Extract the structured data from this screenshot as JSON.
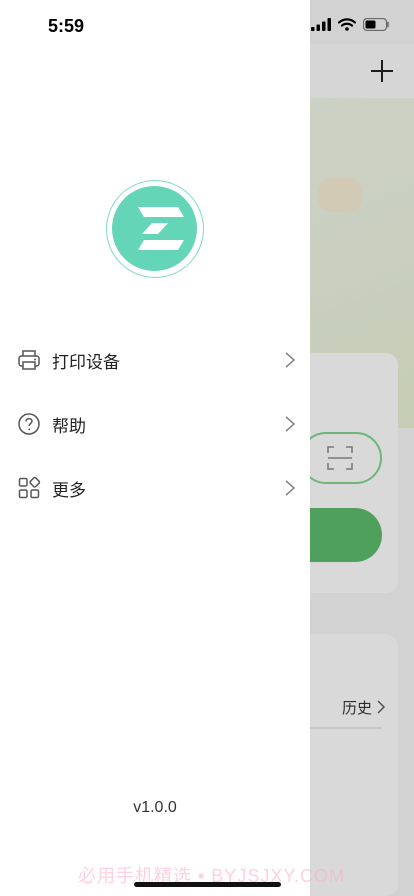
{
  "status_bar": {
    "time": "5:59"
  },
  "background": {
    "history_label": "历史"
  },
  "drawer": {
    "menu": [
      {
        "label": "打印设备",
        "icon": "printer-icon"
      },
      {
        "label": "帮助",
        "icon": "help-circle-icon"
      },
      {
        "label": "更多",
        "icon": "grid-more-icon"
      }
    ],
    "version": "v1.0.0"
  },
  "watermark": "必用手机精选 • BYJSJXY.COM",
  "colors": {
    "brand": "#64d5b6",
    "accent_green": "#5ab66a"
  }
}
